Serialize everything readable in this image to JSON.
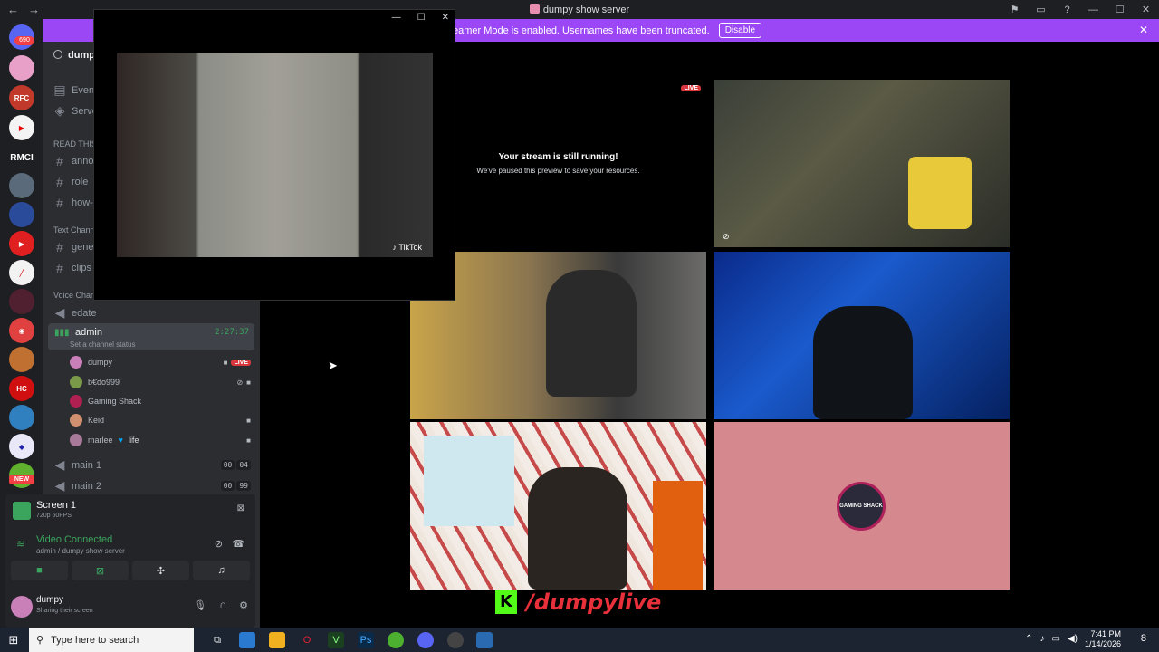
{
  "window": {
    "title": "dumpy show server",
    "nav_back": "←",
    "nav_fwd": "→",
    "min": "—",
    "max": "☐",
    "close": "✕",
    "inbox": "⚑",
    "help": "?"
  },
  "banner": {
    "text": "Streamer Mode is enabled. Usernames have been truncated.",
    "button": "Disable",
    "close": "✕"
  },
  "rail": {
    "dm_badge": "690",
    "rmci": "RMCI",
    "new_badge": "NEW"
  },
  "sidebar": {
    "server_name": "dumpy",
    "events": "Events",
    "server_guide": "Serve",
    "cat_read": "READ THIS",
    "ch_announcements": "annou",
    "ch_roles": "role",
    "ch_howto": "how-t",
    "cat_text": "Text Chann",
    "ch_general": "gener",
    "ch_clips": "clips",
    "cat_voice": "Voice Chan",
    "ch_edate": "edate",
    "vc_name": "admin",
    "vc_time": "2:27:37",
    "vc_status": "Set a channel status",
    "members": [
      {
        "name": "dumpy",
        "live": "LIVE"
      },
      {
        "name": "b€do999"
      },
      {
        "name": "Gaming Shack"
      },
      {
        "name": "Keid"
      },
      {
        "name": "marlee",
        "tag": "life"
      }
    ],
    "main1": {
      "name": "main 1",
      "a": "00",
      "b": "04"
    },
    "main2": {
      "name": "main 2",
      "a": "00",
      "b": "99"
    }
  },
  "panel": {
    "screen_title": "Screen 1",
    "screen_sub": "720p 60FPS",
    "vc_connected": "Video Connected",
    "vc_where": "admin / dumpy show server",
    "user": "dumpy",
    "user_status": "Sharing their screen"
  },
  "stream": {
    "title": "Your stream is still running!",
    "sub": "We've paused this preview to save your resources.",
    "live": "LIVE"
  },
  "tiles": {
    "gaming_shack_logo": "GAMING SHACK"
  },
  "overlay": {
    "k": "K",
    "handle": "/dumpylive"
  },
  "popout": {
    "tiktok": "♪ TikTok"
  },
  "taskbar": {
    "search_placeholder": "Type here to search",
    "time": "7:41 PM",
    "date": "1/14/2026",
    "notif_count": "8"
  }
}
